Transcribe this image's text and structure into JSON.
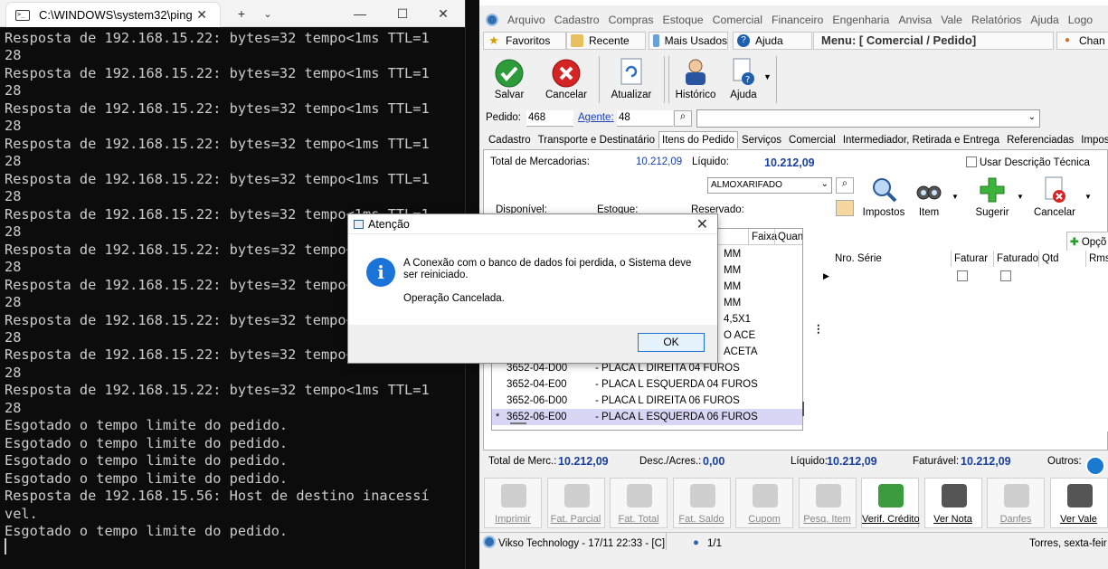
{
  "terminal": {
    "tab_title": "C:\\WINDOWS\\system32\\ping",
    "lines": [
      "Resposta de 192.168.15.22: bytes=32 tempo<1ms TTL=1",
      "28",
      "Resposta de 192.168.15.22: bytes=32 tempo<1ms TTL=1",
      "28",
      "Resposta de 192.168.15.22: bytes=32 tempo<1ms TTL=1",
      "28",
      "Resposta de 192.168.15.22: bytes=32 tempo<1ms TTL=1",
      "28",
      "Resposta de 192.168.15.22: bytes=32 tempo<1ms TTL=1",
      "28",
      "Resposta de 192.168.15.22: bytes=32 tempo<1ms TTL=1",
      "28",
      "Resposta de 192.168.15.22: bytes=32 tempo<1ms TTL=1",
      "28",
      "Resposta de 192.168.15.22: bytes=32 tempo<1ms TTL=1",
      "28",
      "Resposta de 192.168.15.22: bytes=32 tempo<1ms TTL=1",
      "28",
      "Resposta de 192.168.15.22: bytes=32 tempo<1ms TTL=1",
      "28",
      "Resposta de 192.168.15.22: bytes=32 tempo<1ms TTL=1",
      "28",
      "Esgotado o tempo limite do pedido.",
      "Esgotado o tempo limite do pedido.",
      "Esgotado o tempo limite do pedido.",
      "Esgotado o tempo limite do pedido.",
      "Resposta de 192.168.15.56: Host de destino inacessí",
      "vel.",
      "Esgotado o tempo limite do pedido."
    ]
  },
  "erp": {
    "menu": [
      "Arquivo",
      "Cadastro",
      "Compras",
      "Estoque",
      "Comercial",
      "Financeiro",
      "Engenharia",
      "Anvisa",
      "Vale",
      "Relatórios",
      "Ajuda",
      "Logo"
    ],
    "quick": {
      "favoritos": "Favoritos",
      "recente": "Recente",
      "mais_usados": "Mais Usados",
      "ajuda": "Ajuda",
      "menu_title": "Menu: [ Comercial / Pedido]",
      "user": "Chan"
    },
    "toolbar": {
      "salvar": "Salvar",
      "cancelar": "Cancelar",
      "atualizar": "Atualizar",
      "historico": "Histórico",
      "ajuda": "Ajuda"
    },
    "pedido": {
      "label": "Pedido:",
      "value": "468",
      "agente_label": "Agente:",
      "agente_value": "48"
    },
    "tabs": [
      "Cadastro",
      "Transporte e Destinatário",
      "Itens do Pedido",
      "Serviços",
      "Comercial",
      "Intermediador, Retirada e Entrega",
      "Referenciadas",
      "Impostos"
    ],
    "panel": {
      "total_merc_label": "Total de Mercadorias:",
      "total_merc_value": "10.212,09",
      "liquido_label": "Líquido:",
      "liquido_value": "10.212,09",
      "usar_desc": "Usar Descrição Técnica",
      "almox": "ALMOXARIFADO",
      "disponivel": "Disponível:",
      "estoque": "Estoque:",
      "reservado": "Reservado:",
      "btn_impostos": "Impostos",
      "btn_item": "Item",
      "btn_sugerir": "Sugerir",
      "btn_cancelar": "Cancelar",
      "btn_opcoes": "Opçõ",
      "col_faixa": "Faixa",
      "col_quan": "Quan",
      "partial_rows": [
        "MM",
        "MM",
        "MM",
        "MM",
        "4,5X1",
        "O ACE",
        "ACETA"
      ],
      "rows": [
        {
          "code": "3652-04-D00",
          "desc": "- PLACA L DIREITA 04 FUROS"
        },
        {
          "code": "3652-04-E00",
          "desc": "- PLACA L ESQUERDA 04 FUROS"
        },
        {
          "code": "3652-06-D00",
          "desc": "- PLACA L DIREITA 06 FUROS"
        },
        {
          "code": "3652-06-E00",
          "desc": "- PLACA L ESQUERDA 06 FUROS"
        }
      ],
      "grid2_cols": [
        "Nro. Série",
        "Faturar",
        "Faturado",
        "Qtd",
        "Rms"
      ]
    },
    "totals": {
      "merc_label": "Total de Merc.:",
      "merc_value": "10.212,09",
      "desc_label": "Desc./Acres.:",
      "desc_value": "0,00",
      "liquido_label": "Líquido:",
      "liquido_value": "10.212,09",
      "faturavel_label": "Faturável:",
      "faturavel_value": "10.212,09",
      "outros_label": "Outros:"
    },
    "buttons": [
      "Imprimir",
      "Fat. Parcial",
      "Fat. Total",
      "Fat. Saldo",
      "Cupom",
      "Pesq. Item",
      "Verif. Crédito",
      "Ver Nota",
      "Danfes",
      "Ver Vale"
    ],
    "status": {
      "company": "Vikso Technology - 17/11 22:33 - [C]",
      "pages": "1/1",
      "right": "Torres, sexta-feir"
    }
  },
  "dialog": {
    "title": "Atenção",
    "message": "A Conexão com o banco de dados foi perdida, o Sistema deve ser reiniciado.",
    "sub": "Operação Cancelada.",
    "ok": "OK"
  }
}
